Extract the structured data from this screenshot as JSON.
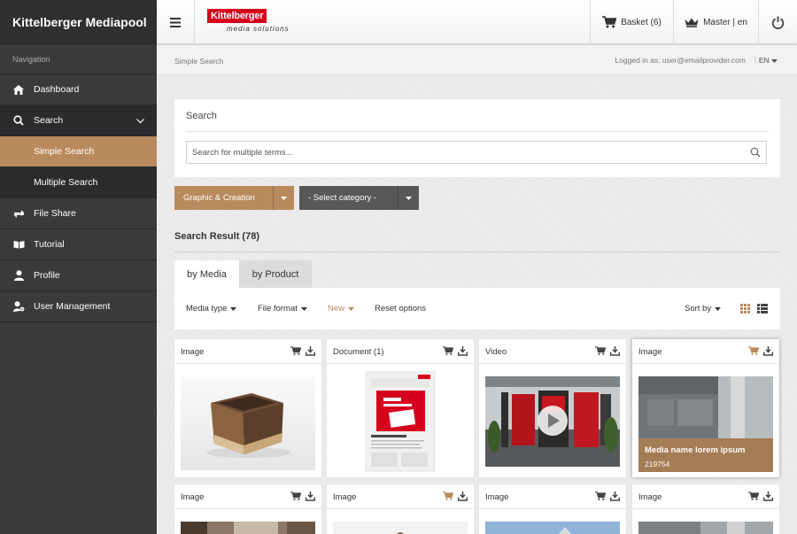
{
  "app": {
    "title": "Kittelberger Mediapool",
    "logo_main": "Kittelberger",
    "logo_sub": "media solutions"
  },
  "nav": {
    "heading": "Navigation",
    "items": [
      {
        "label": "Dashboard",
        "icon": "home-icon"
      },
      {
        "label": "Search",
        "icon": "search-icon"
      },
      {
        "label": "Simple Search"
      },
      {
        "label": "Multiple Search"
      },
      {
        "label": "File Share",
        "icon": "share-icon"
      },
      {
        "label": "Tutorial",
        "icon": "book-icon"
      },
      {
        "label": "Profile",
        "icon": "user-icon"
      },
      {
        "label": "User Management",
        "icon": "user-gear-icon"
      }
    ]
  },
  "header": {
    "basket": "Basket (6)",
    "master": "Master | en"
  },
  "crumbbar": {
    "breadcrumb": "Simple Search",
    "logged_in": "Logged in as: user@emailprovider.com",
    "separator": "|",
    "lang": "EN"
  },
  "search": {
    "title": "Search",
    "placeholder": "Search for multiple terms..."
  },
  "filters": {
    "dropdown1": "Graphic & Creation",
    "dropdown2": "- Select category -",
    "result_title": "Search Result (78)",
    "tab_media": "by Media",
    "tab_product": "by Product",
    "media_type": "Media type",
    "file_format": "File format",
    "new": "New",
    "reset": "Reset options",
    "sort_by": "Sort by"
  },
  "colors": {
    "accent": "#b98a5e",
    "sidebar": "#3a3a3c",
    "logo_red": "#d6001c"
  },
  "cards": [
    {
      "label": "Image"
    },
    {
      "label": "Document (1)"
    },
    {
      "label": "Video"
    },
    {
      "label": "Image",
      "overlay_name": "Media name lorem ipsum",
      "overlay_id": "219754"
    },
    {
      "label": "Image"
    },
    {
      "label": "Image"
    },
    {
      "label": "Image"
    },
    {
      "label": "Image"
    }
  ]
}
